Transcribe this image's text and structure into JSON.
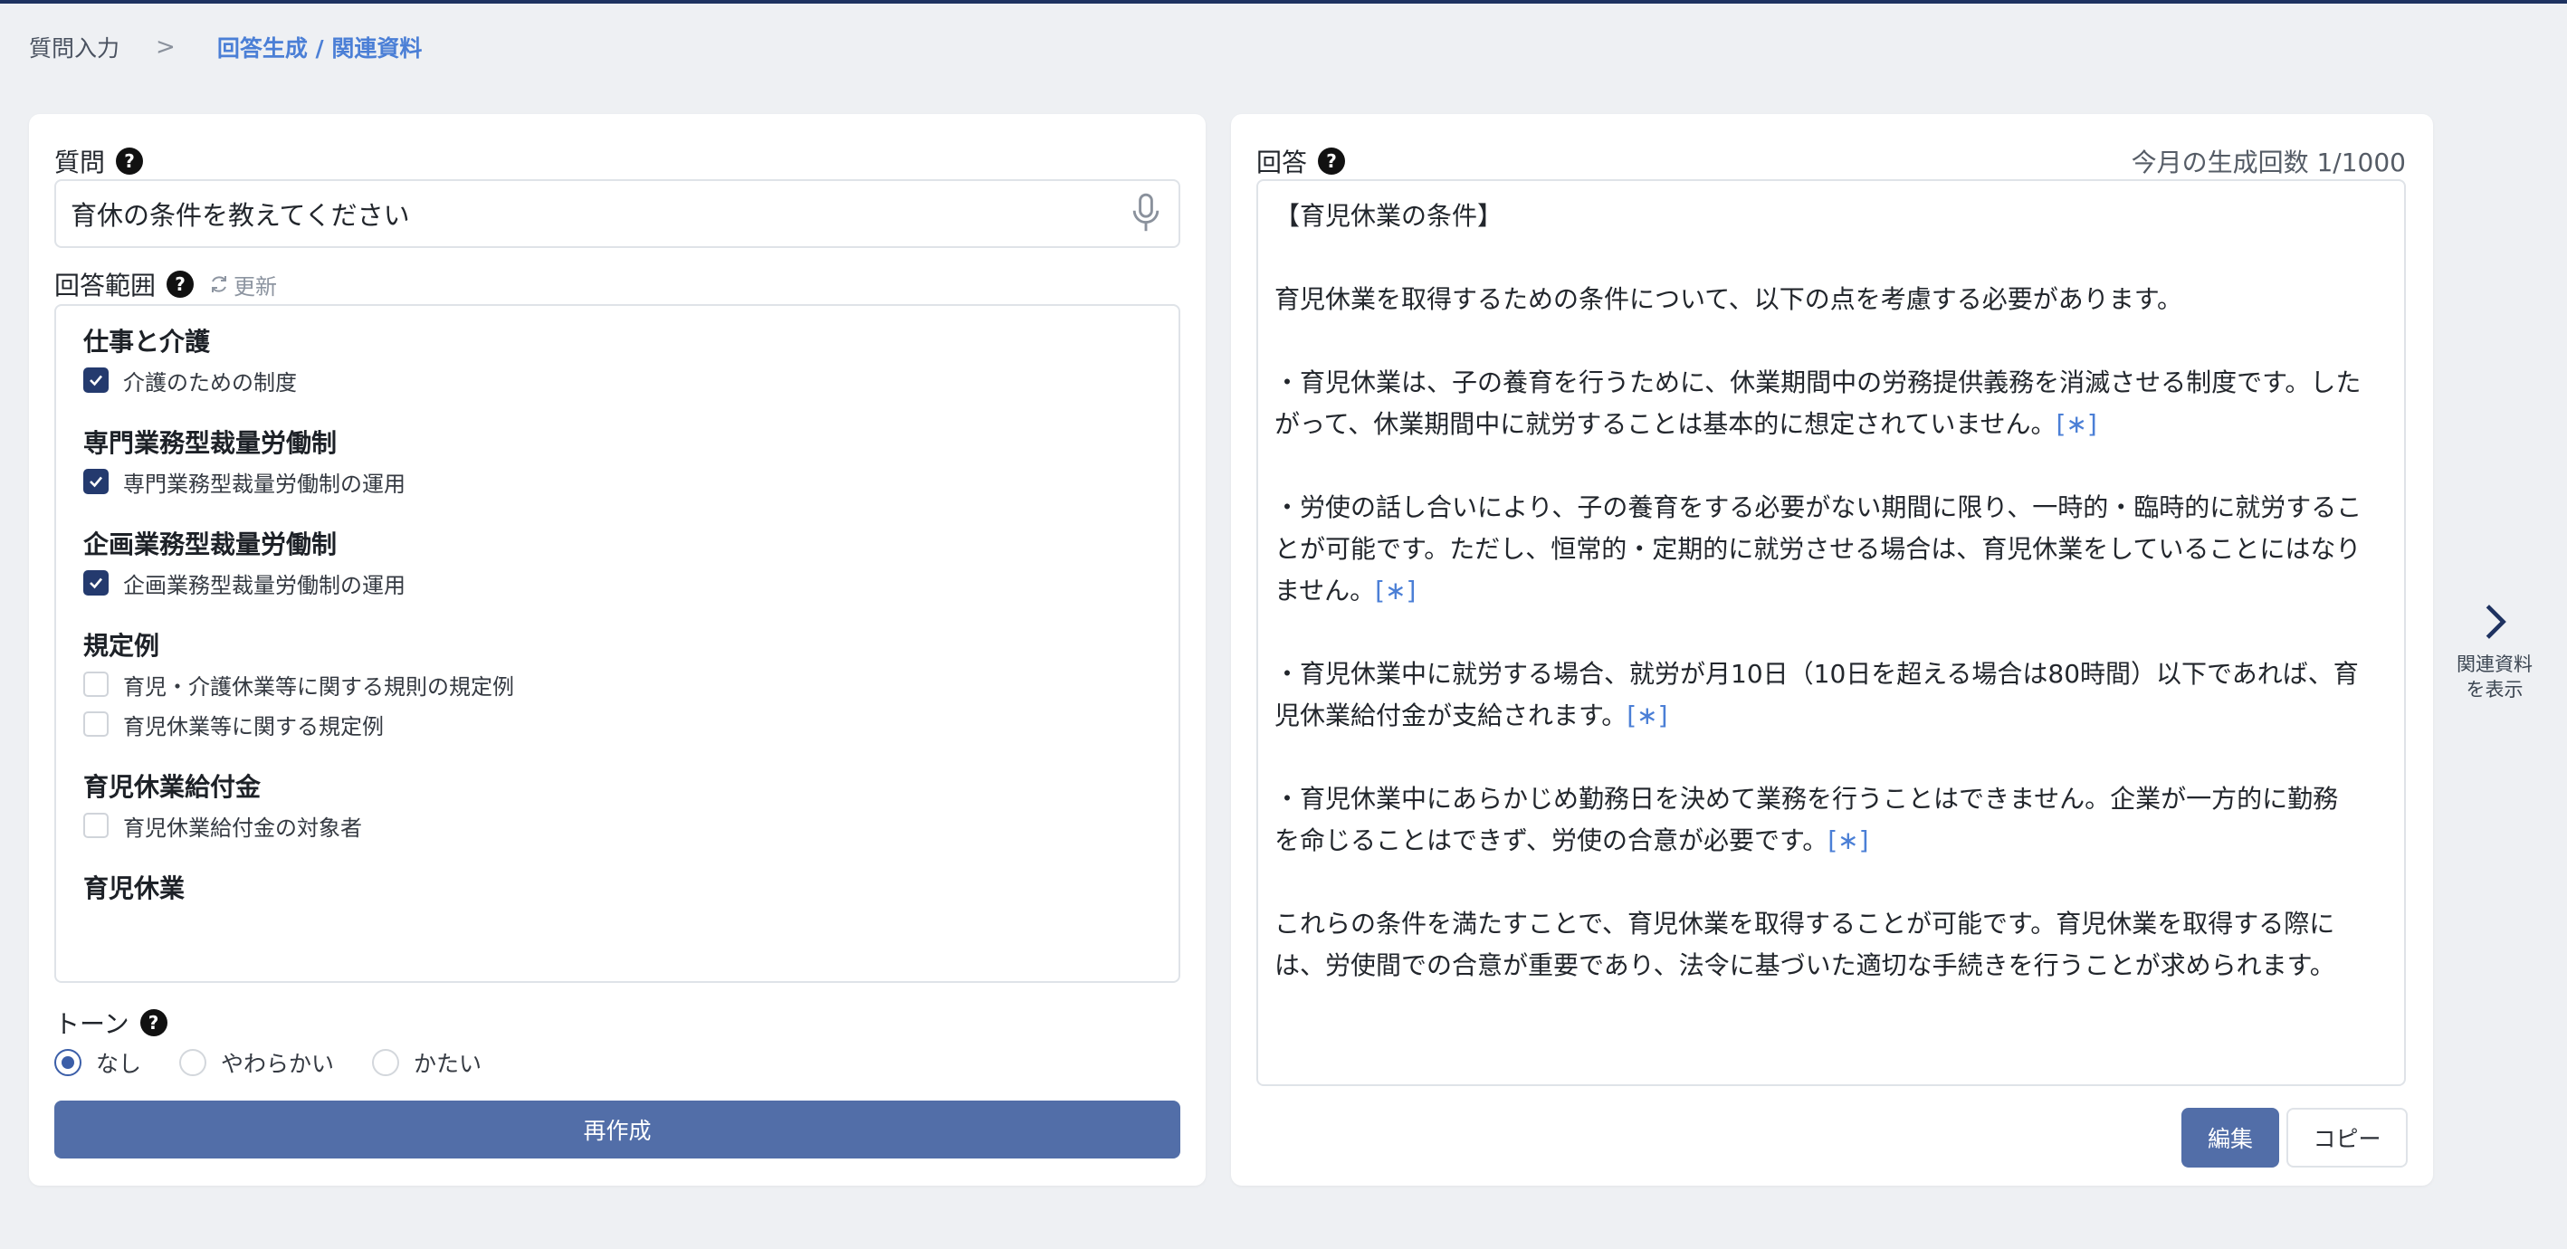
{
  "breadcrumb": {
    "step1": "質問入力",
    "separator": ">",
    "step2": "回答生成 / 関連資料"
  },
  "question": {
    "label": "質問",
    "help": "?",
    "value": "育休の条件を教えてください",
    "icon": "microphone-icon"
  },
  "scope": {
    "label": "回答範囲",
    "help": "?",
    "refresh_label": "更新",
    "groups": [
      {
        "title": "仕事と介護",
        "items": [
          {
            "label": "介護のための制度",
            "checked": true
          }
        ]
      },
      {
        "title": "専門業務型裁量労働制",
        "items": [
          {
            "label": "専門業務型裁量労働制の運用",
            "checked": true
          }
        ]
      },
      {
        "title": "企画業務型裁量労働制",
        "items": [
          {
            "label": "企画業務型裁量労働制の運用",
            "checked": true
          }
        ]
      },
      {
        "title": "規定例",
        "items": [
          {
            "label": "育児・介護休業等に関する規則の規定例",
            "checked": false
          },
          {
            "label": "育児休業等に関する規定例",
            "checked": false
          }
        ]
      },
      {
        "title": "育児休業給付金",
        "items": [
          {
            "label": "育児休業給付金の対象者",
            "checked": false
          }
        ]
      },
      {
        "title": "育児休業",
        "items": []
      }
    ]
  },
  "tone": {
    "label": "トーン",
    "help": "?",
    "options": [
      {
        "label": "なし",
        "selected": true
      },
      {
        "label": "やわらかい",
        "selected": false
      },
      {
        "label": "かたい",
        "selected": false
      }
    ]
  },
  "regenerate_label": "再作成",
  "answer": {
    "label": "回答",
    "help": "?",
    "count_label": "今月の生成回数",
    "count_value": "1/1000",
    "title": "【育児休業の条件】",
    "intro": "育児休業を取得するための条件について、以下の点を考慮する必要があります。",
    "point1a": "・育児休業は、子の養育を行うために、休業期間中の労務提供義務を消滅させる制度です。した",
    "point1b": "がって、休業期間中に就労することは基本的に想定されていません。",
    "point2a": "・労使の話し合いにより、子の養育をする必要がない期間に限り、一時的・臨時的に就労するこ",
    "point2b": "とが可能です。ただし、恒常的・定期的に就労させる場合は、育児休業をしていることにはなり",
    "point2c": "ません。",
    "point3a": "・育児休業中に就労する場合、就労が月10日（10日を超える場合は80時間）以下であれば、育",
    "point3b": "児休業給付金が支給されます。",
    "point4a": "・育児休業中にあらかじめ勤務日を決めて業務を行うことはできません。企業が一方的に勤務",
    "point4b": "を命じることはできず、労使の合意が必要です。",
    "concl_a": "これらの条件を満たすことで、育児休業を取得することが可能です。育児休業を取得する際に",
    "concl_b": "は、労使間での合意が重要であり、法令に基づいた適切な手続きを行うことが求められます。",
    "cite": "[∗]"
  },
  "edit_label": "編集",
  "copy_label": "コピー",
  "side_toggle": {
    "line1": "関連資料",
    "line2": "を表示",
    "icon": "chevron-right-icon"
  },
  "colors": {
    "primary": "#526ea8",
    "link": "#4b7fd6",
    "checkbox": "#243a6e",
    "background": "#eef0f3"
  }
}
